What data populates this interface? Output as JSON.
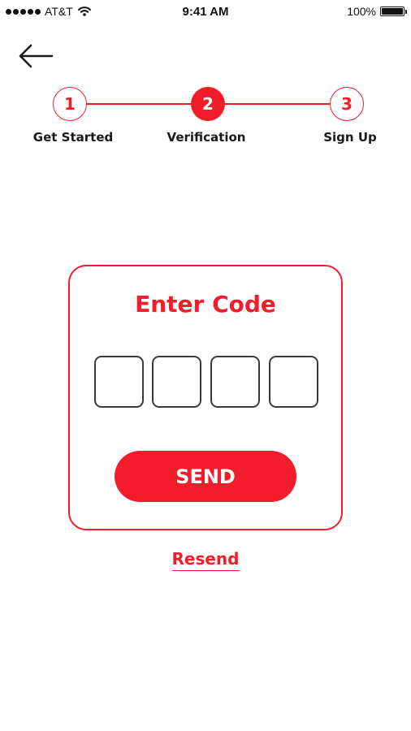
{
  "status_bar": {
    "carrier": "AT&T",
    "time": "9:41 AM",
    "battery_percent": "100%",
    "battery_level": 1.0,
    "signal_icon": "signal-dots-icon",
    "wifi_icon": "wifi-icon",
    "battery_icon": "battery-icon"
  },
  "nav": {
    "back_icon": "arrow-left-icon"
  },
  "stepper": {
    "accent_color": "#f21c2a",
    "active_step": 2,
    "steps": [
      {
        "number": "1",
        "label": "Get Started",
        "state": "outline"
      },
      {
        "number": "2",
        "label": "Verification",
        "state": "active"
      },
      {
        "number": "3",
        "label": "Sign Up",
        "state": "outline"
      }
    ]
  },
  "verification": {
    "title": "Enter Code",
    "code_digits": [
      "",
      "",
      "",
      ""
    ],
    "send_label": "SEND",
    "resend_label": "Resend"
  }
}
